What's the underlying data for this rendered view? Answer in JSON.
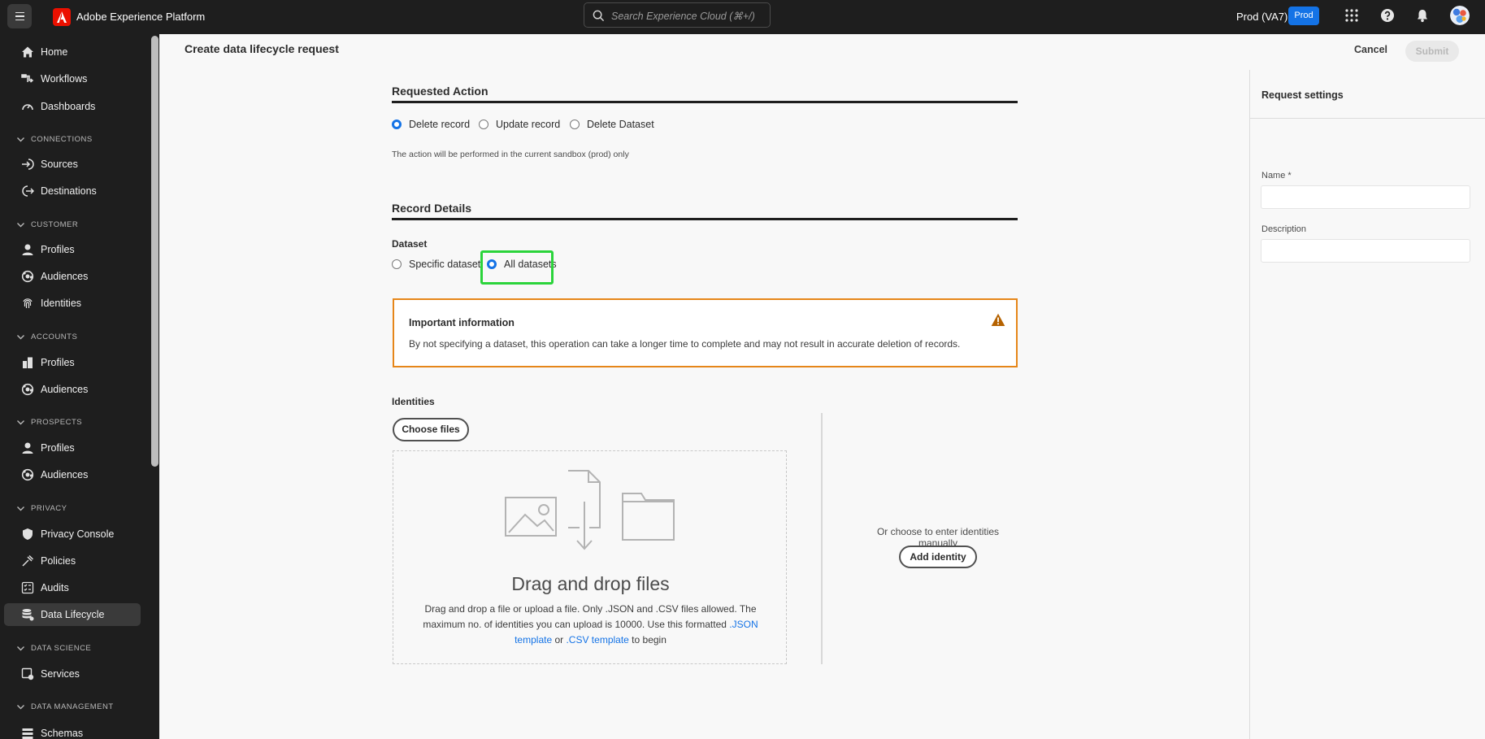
{
  "topbar": {
    "app_title": "Adobe Experience Platform",
    "search_placeholder": "Search Experience Cloud (⌘+/)",
    "org_name": "Prod (VA7)",
    "sandbox_badge": "Prod",
    "icons": [
      "menu-icon",
      "adobe-logo",
      "search-icon",
      "apps-grid-icon",
      "help-icon",
      "bell-icon",
      "avatar"
    ]
  },
  "sidebar": {
    "items": [
      {
        "label": "Home",
        "icon": "home-icon"
      },
      {
        "label": "Workflows",
        "icon": "workflows-icon"
      },
      {
        "label": "Dashboards",
        "icon": "dashboard-icon"
      }
    ],
    "sections": {
      "connections": {
        "label": "CONNECTIONS",
        "items": [
          {
            "label": "Sources",
            "icon": "sources-icon"
          },
          {
            "label": "Destinations",
            "icon": "destinations-icon"
          }
        ]
      },
      "customer": {
        "label": "CUSTOMER",
        "items": [
          {
            "label": "Profiles",
            "icon": "profile-icon"
          },
          {
            "label": "Audiences",
            "icon": "audiences-icon"
          },
          {
            "label": "Identities",
            "icon": "fingerprint-icon"
          }
        ]
      },
      "accounts": {
        "label": "ACCOUNTS",
        "items": [
          {
            "label": "Profiles",
            "icon": "building-icon"
          },
          {
            "label": "Audiences",
            "icon": "audiences-icon"
          }
        ]
      },
      "prospects": {
        "label": "PROSPECTS",
        "items": [
          {
            "label": "Profiles",
            "icon": "profile-icon"
          },
          {
            "label": "Audiences",
            "icon": "audiences-icon"
          }
        ]
      },
      "privacy": {
        "label": "PRIVACY",
        "items": [
          {
            "label": "Privacy Console",
            "icon": "shield-icon"
          },
          {
            "label": "Policies",
            "icon": "policies-icon"
          },
          {
            "label": "Audits",
            "icon": "audits-icon"
          },
          {
            "label": "Data Lifecycle",
            "icon": "data-lifecycle-icon",
            "active": true
          }
        ]
      },
      "data_science": {
        "label": "DATA SCIENCE",
        "items": [
          {
            "label": "Services",
            "icon": "services-icon"
          }
        ]
      },
      "data_management": {
        "label": "DATA MANAGEMENT",
        "items": [
          {
            "label": "Schemas",
            "icon": "schemas-icon"
          }
        ]
      }
    }
  },
  "header": {
    "title": "Create data lifecycle request",
    "cancel_label": "Cancel",
    "submit_label": "Submit"
  },
  "requested_action": {
    "heading": "Requested Action",
    "options": [
      {
        "label": "Delete record",
        "selected": true
      },
      {
        "label": "Update record",
        "selected": false
      },
      {
        "label": "Delete Dataset",
        "selected": false
      }
    ],
    "note": "The action will be performed in the current sandbox (prod) only"
  },
  "record_details": {
    "heading": "Record Details",
    "dataset_label": "Dataset",
    "dataset_options": [
      {
        "label": "Specific dataset",
        "selected": false
      },
      {
        "label": "All datasets",
        "selected": true
      }
    ],
    "alert": {
      "title": "Important information",
      "text": "By not specifying a dataset, this operation can take a longer time to complete and may not result in accurate deletion of records.",
      "icon": "alert-icon"
    },
    "identities_label": "Identities",
    "choose_files_label": "Choose files",
    "dropzone": {
      "title": "Drag and drop files",
      "text_1": "Drag and drop a file or upload a file. Only .JSON and .CSV files allowed. The maximum no. of identities you can upload is 10000. Use this formatted ",
      "json_link": ".JSON template",
      "text_2": " or ",
      "csv_link": ".CSV template",
      "text_3": " to begin"
    },
    "manual_text": "Or choose to enter identities manually",
    "add_identity_label": "Add identity"
  },
  "request_settings": {
    "title": "Request settings",
    "name_label": "Name *",
    "name_value": "",
    "description_label": "Description",
    "description_value": ""
  },
  "colors": {
    "accent": "#1473e6",
    "highlight": "#2bd43b",
    "warning": "#e68619",
    "topbar_bg": "#1e1e1e"
  }
}
